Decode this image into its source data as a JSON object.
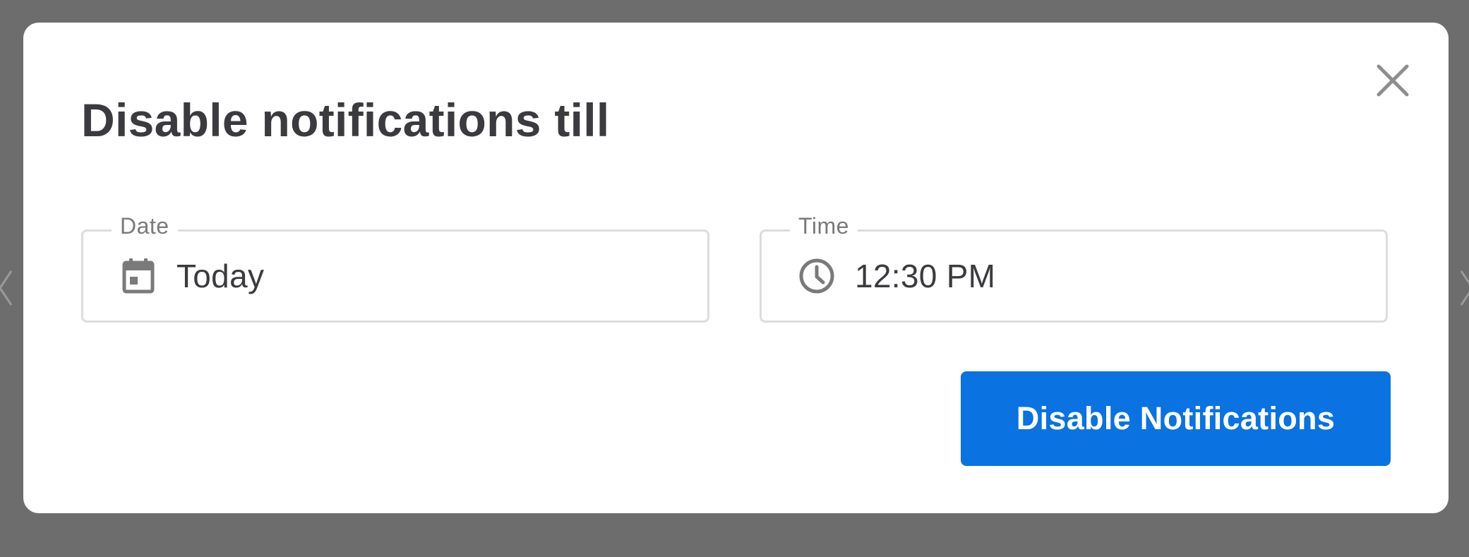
{
  "dialog": {
    "title": "Disable notifications till",
    "close_icon": "close-icon"
  },
  "date_field": {
    "label": "Date",
    "value": "Today",
    "icon": "calendar-icon"
  },
  "time_field": {
    "label": "Time",
    "value": "12:30 PM",
    "icon": "clock-icon"
  },
  "actions": {
    "primary_label": "Disable Notifications"
  },
  "colors": {
    "accent": "#0a72e1",
    "overlay": "#6d6d6d",
    "text": "#3b3b3f",
    "border": "#dddddd"
  }
}
